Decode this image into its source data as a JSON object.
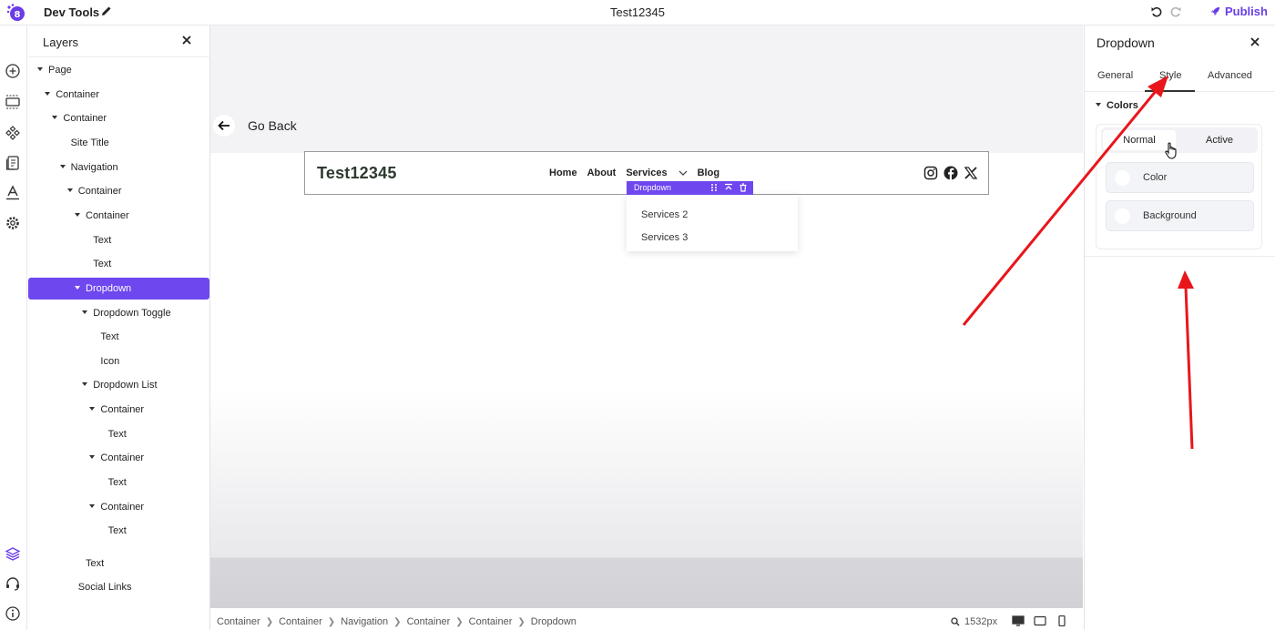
{
  "topbar": {
    "app_title": "Dev Tools",
    "doc_title": "Test12345",
    "publish_label": "Publish",
    "accent_color": "#6a3de8"
  },
  "rail": {
    "icons": [
      "add-icon",
      "section-icon",
      "components-icon",
      "pages-icon",
      "typography-icon",
      "settings-icon",
      "layers-icon",
      "support-icon",
      "info-icon"
    ]
  },
  "layers": {
    "title": "Layers",
    "items": [
      {
        "label": "Page",
        "expandable": true
      },
      {
        "label": "Container",
        "expandable": true
      },
      {
        "label": "Container",
        "expandable": true
      },
      {
        "label": "Site Title",
        "expandable": false
      },
      {
        "label": "Navigation",
        "expandable": true
      },
      {
        "label": "Container",
        "expandable": true
      },
      {
        "label": "Container",
        "expandable": true
      },
      {
        "label": "Text",
        "expandable": false
      },
      {
        "label": "Text",
        "expandable": false
      },
      {
        "label": "Dropdown",
        "expandable": true,
        "selected": true
      },
      {
        "label": "Dropdown Toggle",
        "expandable": true
      },
      {
        "label": "Text",
        "expandable": false
      },
      {
        "label": "Icon",
        "expandable": false
      },
      {
        "label": "Dropdown List",
        "expandable": true
      },
      {
        "label": "Container",
        "expandable": true
      },
      {
        "label": "Text",
        "expandable": false
      },
      {
        "label": "Container",
        "expandable": true
      },
      {
        "label": "Text",
        "expandable": false
      },
      {
        "label": "Container",
        "expandable": true
      },
      {
        "label": "Text",
        "expandable": false
      },
      {
        "label": "Text",
        "expandable": false
      },
      {
        "label": "Social Links",
        "expandable": false
      }
    ],
    "selected_color": "#6e47ef"
  },
  "canvas": {
    "go_back_label": "Go Back",
    "site_title": "Test12345",
    "nav": [
      "Home",
      "About",
      "Services",
      "Blog"
    ],
    "dropdown_tag": "Dropdown",
    "dropdown_items": [
      "Services 2",
      "Services 3"
    ],
    "social_icons": [
      "instagram-icon",
      "facebook-icon",
      "x-icon"
    ]
  },
  "breadcrumb": {
    "items": [
      "Container",
      "Container",
      "Navigation",
      "Container",
      "Container",
      "Dropdown"
    ],
    "zoom": "1532px"
  },
  "right_panel": {
    "title": "Dropdown",
    "tabs": [
      "General",
      "Style",
      "Advanced"
    ],
    "active_tab": "Style",
    "section": "Colors",
    "state_normal": "Normal",
    "state_active": "Active",
    "fields": [
      "Color",
      "Background"
    ]
  },
  "annotation_color": "#e8161b"
}
